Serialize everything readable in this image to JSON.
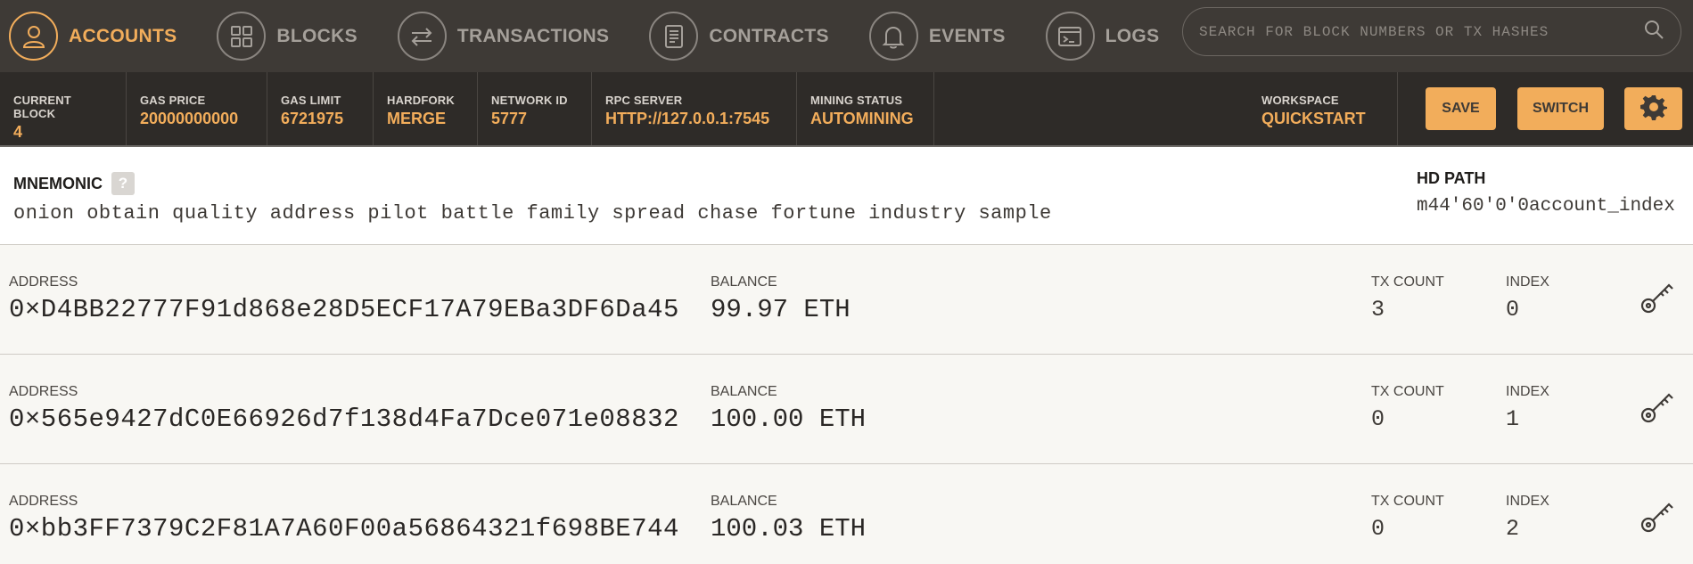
{
  "nav": {
    "items": [
      {
        "label": "ACCOUNTS",
        "icon": "user-icon",
        "active": true
      },
      {
        "label": "BLOCKS",
        "icon": "grid-icon",
        "active": false
      },
      {
        "label": "TRANSACTIONS",
        "icon": "swap-arrows-icon",
        "active": false
      },
      {
        "label": "CONTRACTS",
        "icon": "document-icon",
        "active": false
      },
      {
        "label": "EVENTS",
        "icon": "bell-icon",
        "active": false
      },
      {
        "label": "LOGS",
        "icon": "terminal-icon",
        "active": false
      }
    ],
    "search_placeholder": "SEARCH FOR BLOCK NUMBERS OR TX HASHES"
  },
  "status": {
    "current_block_label": "CURRENT BLOCK",
    "current_block": "4",
    "gas_price_label": "GAS PRICE",
    "gas_price": "20000000000",
    "gas_limit_label": "GAS LIMIT",
    "gas_limit": "6721975",
    "hardfork_label": "HARDFORK",
    "hardfork": "MERGE",
    "network_id_label": "NETWORK ID",
    "network_id": "5777",
    "rpc_server_label": "RPC SERVER",
    "rpc_server": "HTTP://127.0.0.1:7545",
    "mining_status_label": "MINING STATUS",
    "mining_status": "AUTOMINING",
    "workspace_label": "WORKSPACE",
    "workspace": "QUICKSTART",
    "save_label": "SAVE",
    "switch_label": "SWITCH"
  },
  "mnemonic": {
    "title": "MNEMONIC",
    "help": "?",
    "words": "onion obtain quality address pilot battle family spread chase fortune industry sample",
    "hd_path_label": "HD PATH",
    "hd_path": "m44'60'0'0account_index"
  },
  "accounts": [
    {
      "address_label": "ADDRESS",
      "address": "0×D4BB22777F91d868e28D5ECF17A79EBa3DF6Da45",
      "balance_label": "BALANCE",
      "balance": "99.97 ETH",
      "tx_count_label": "TX COUNT",
      "tx_count": "3",
      "index_label": "INDEX",
      "index": "0"
    },
    {
      "address_label": "ADDRESS",
      "address": "0×565e9427dC0E66926d7f138d4Fa7Dce071e08832",
      "balance_label": "BALANCE",
      "balance": "100.00 ETH",
      "tx_count_label": "TX COUNT",
      "tx_count": "0",
      "index_label": "INDEX",
      "index": "1"
    },
    {
      "address_label": "ADDRESS",
      "address": "0×bb3FF7379C2F81A7A60F00a56864321f698BE744",
      "balance_label": "BALANCE",
      "balance": "100.03 ETH",
      "tx_count_label": "TX COUNT",
      "tx_count": "0",
      "index_label": "INDEX",
      "index": "2"
    }
  ],
  "colors": {
    "accent": "#f2ad5b",
    "nav_bg": "#3e3a36",
    "status_bg": "#2e2b28"
  }
}
